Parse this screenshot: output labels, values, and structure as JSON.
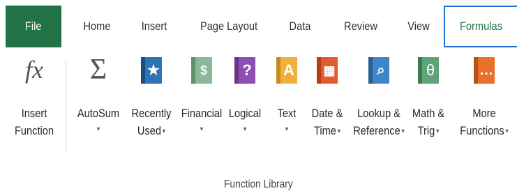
{
  "tabs": [
    {
      "id": "file",
      "label": "File"
    },
    {
      "id": "home",
      "label": "Home"
    },
    {
      "id": "insert",
      "label": "Insert"
    },
    {
      "id": "page_layout",
      "label": "Page Layout"
    },
    {
      "id": "data",
      "label": "Data"
    },
    {
      "id": "review",
      "label": "Review"
    },
    {
      "id": "view",
      "label": "View"
    },
    {
      "id": "formulas",
      "label": "Formulas"
    }
  ],
  "active_tab": "Formulas",
  "colors": {
    "file_tab_bg": "#217346",
    "active_border": "#1e73d2",
    "active_text": "#217346"
  },
  "commands": {
    "insert_function": {
      "line1": "Insert",
      "line2": "Function",
      "icon": "fx-icon",
      "glyph": "fx"
    },
    "autosum": {
      "line1": "AutoSum",
      "line2": "▾",
      "icon": "sigma-icon",
      "glyph": "Σ"
    },
    "recently_used": {
      "line1": "Recently",
      "line2": "Used",
      "icon": "star-book-icon",
      "glyph": "★"
    },
    "financial": {
      "line1": "Financial",
      "line2": "▾",
      "icon": "coins-book-icon",
      "glyph": "$"
    },
    "logical": {
      "line1": "Logical",
      "line2": "▾",
      "icon": "question-book-icon",
      "glyph": "?"
    },
    "text": {
      "line1": "Text",
      "line2": "▾",
      "icon": "text-book-icon",
      "glyph": "A"
    },
    "date_time": {
      "line1": "Date &",
      "line2": "Time",
      "icon": "calendar-book-icon",
      "glyph": "▦"
    },
    "lookup_reference": {
      "line1": "Lookup &",
      "line2": "Reference",
      "icon": "magnifier-book-icon",
      "glyph": "⌕"
    },
    "math_trig": {
      "line1": "Math &",
      "line2": "Trig",
      "icon": "theta-book-icon",
      "glyph": "θ"
    },
    "more_functions": {
      "line1": "More",
      "line2": "Functions",
      "icon": "ellipsis-book-icon",
      "glyph": "…"
    }
  },
  "group_label": "Function Library"
}
